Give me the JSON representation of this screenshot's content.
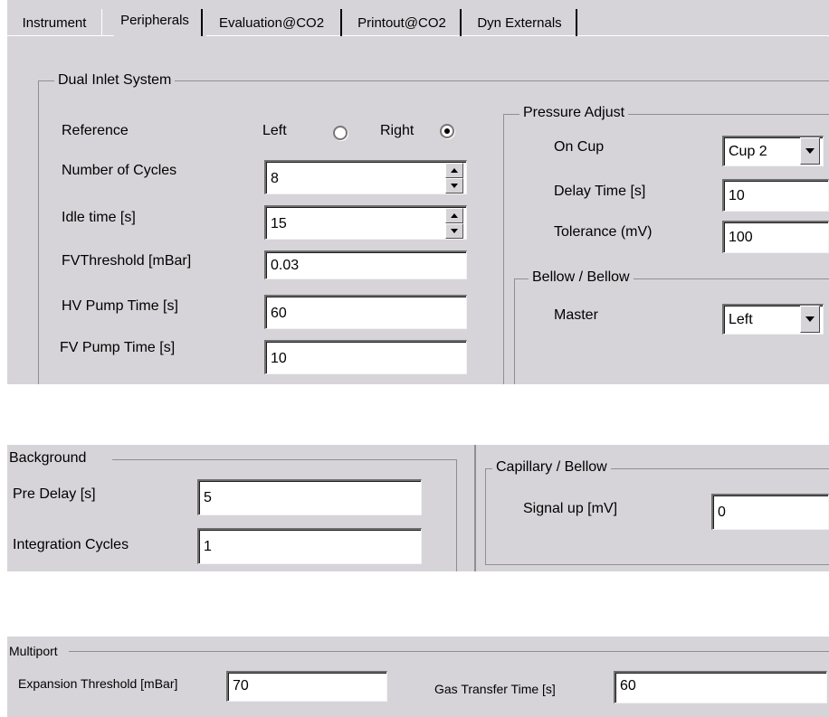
{
  "tabs": [
    {
      "label": "Instrument"
    },
    {
      "label": "Peripherals"
    },
    {
      "label": "Evaluation@CO2"
    },
    {
      "label": "Printout@CO2"
    },
    {
      "label": "Dyn Externals"
    }
  ],
  "dual_inlet": {
    "title": "Dual Inlet System",
    "reference": {
      "label": "Reference",
      "left_label": "Left",
      "right_label": "Right",
      "selected": "Right"
    },
    "cycles": {
      "label": "Number of Cycles",
      "value": "8"
    },
    "idle": {
      "label": "Idle time [s]",
      "value": "15"
    },
    "fv_threshold": {
      "label": "FVThreshold [mBar]",
      "value": "0.03"
    },
    "hv_pump": {
      "label": "HV Pump Time [s]",
      "value": "60"
    },
    "fv_pump": {
      "label": "FV Pump Time [s]",
      "value": "10"
    }
  },
  "pressure_adjust": {
    "title": "Pressure Adjust",
    "on_cup": {
      "label": "On Cup",
      "value": "Cup 2"
    },
    "delay": {
      "label": "Delay Time [s]",
      "value": "10"
    },
    "tolerance": {
      "label": "Tolerance (mV)",
      "value": "100"
    }
  },
  "bellow": {
    "title": "Bellow / Bellow",
    "master": {
      "label": "Master",
      "value": "Left"
    }
  },
  "background": {
    "title": "Background",
    "pre_delay": {
      "label": "Pre Delay [s]",
      "value": "5"
    },
    "integration": {
      "label": "Integration Cycles",
      "value": "1"
    }
  },
  "capillary": {
    "title": "Capillary / Bellow",
    "signal": {
      "label": "Signal up [mV]",
      "value": "0"
    }
  },
  "multiport": {
    "title": "Multiport",
    "expansion": {
      "label": "Expansion Threshold [mBar]",
      "value": "70"
    },
    "gas_transfer": {
      "label": "Gas Transfer Time [s]",
      "value": "60"
    }
  },
  "colors": {
    "panel": "#d7d4d9",
    "field": "#ffffff"
  }
}
